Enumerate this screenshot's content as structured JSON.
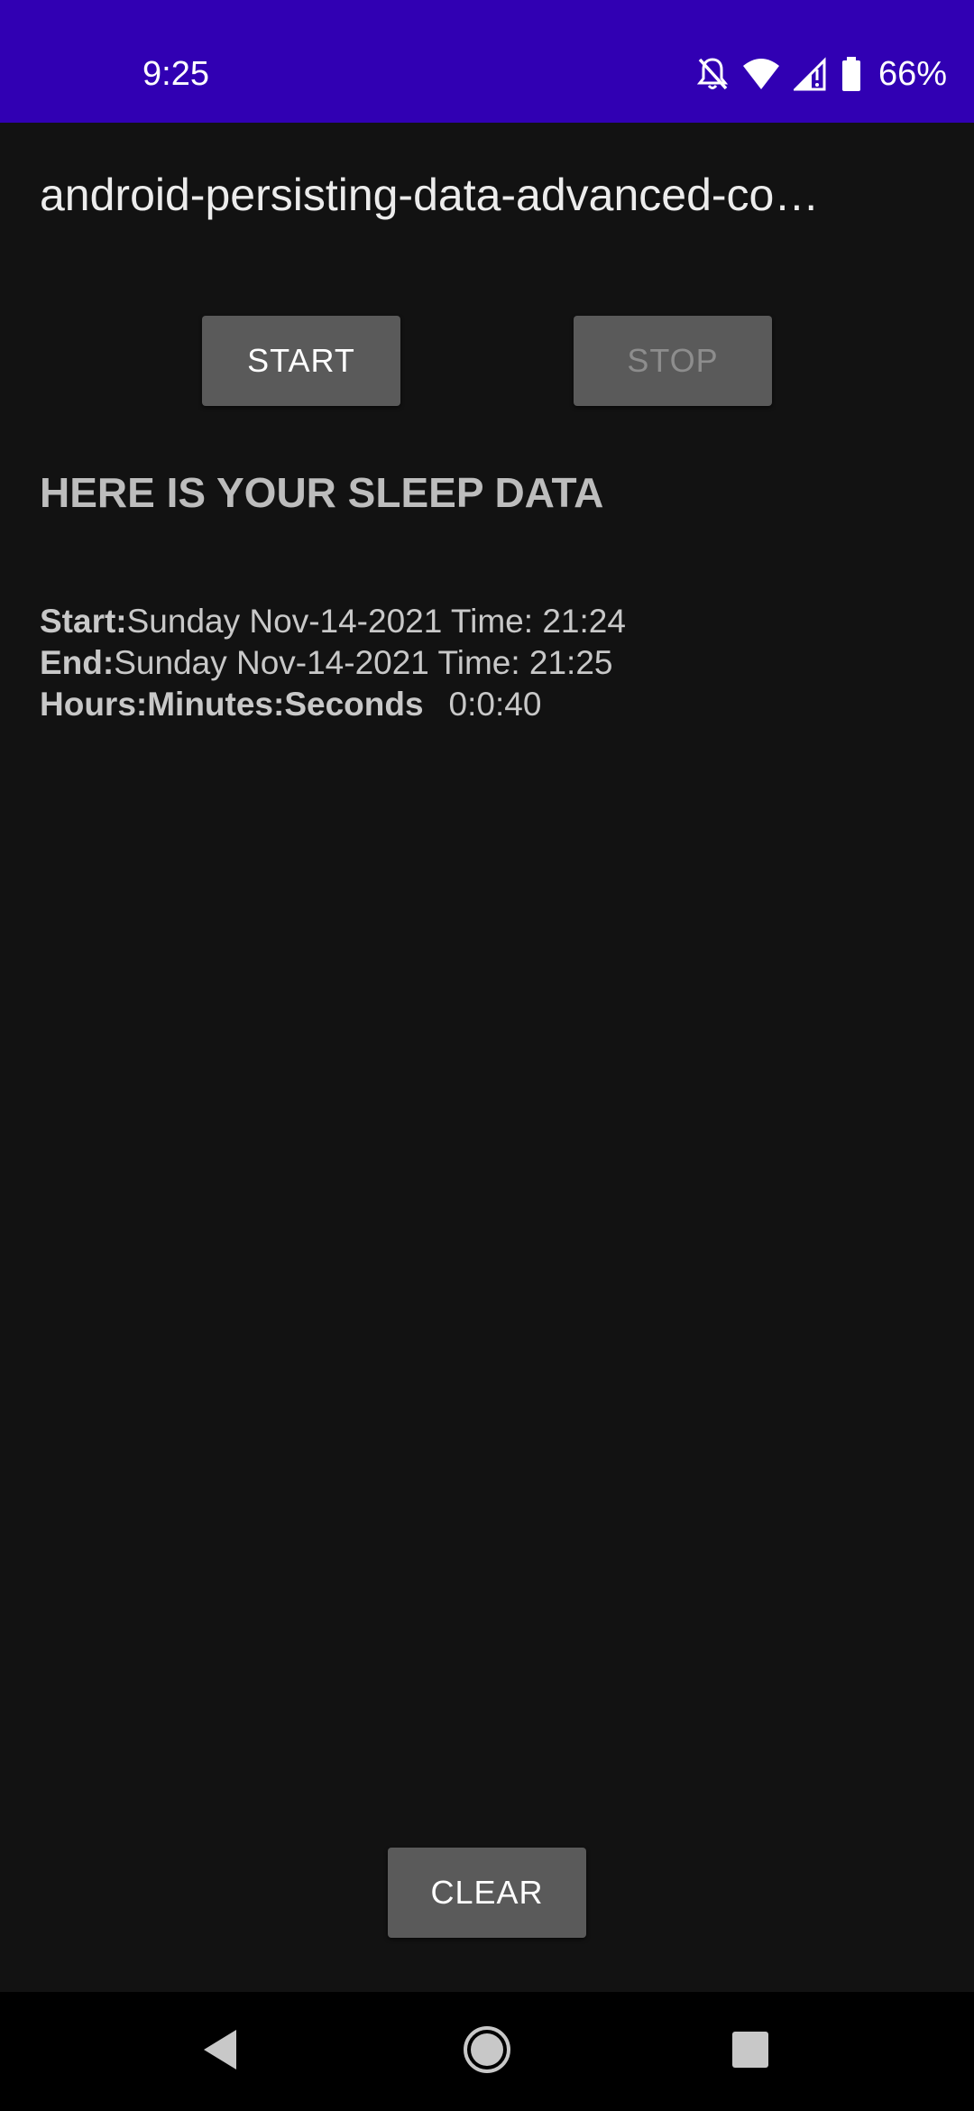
{
  "status_bar": {
    "time": "9:25",
    "battery_percent": "66%",
    "icons": [
      "bell-off-icon",
      "wifi-icon",
      "signal-icon",
      "battery-icon"
    ],
    "background_color": "#3100b3"
  },
  "app": {
    "title": "android-persisting-data-advanced-co…"
  },
  "controls": {
    "start_label": "START",
    "stop_label": "STOP",
    "stop_enabled": false,
    "clear_label": "CLEAR"
  },
  "sleep": {
    "heading": "HERE IS YOUR SLEEP DATA",
    "start_label": "Start:",
    "start_value": "Sunday Nov-14-2021 Time: 21:24",
    "end_label": "End:",
    "end_value": "Sunday Nov-14-2021 Time: 21:25",
    "duration_label": "Hours:Minutes:Seconds",
    "duration_value": "0:0:40"
  },
  "nav_bar": {
    "icons": [
      "back-icon",
      "home-icon",
      "recents-icon"
    ]
  }
}
